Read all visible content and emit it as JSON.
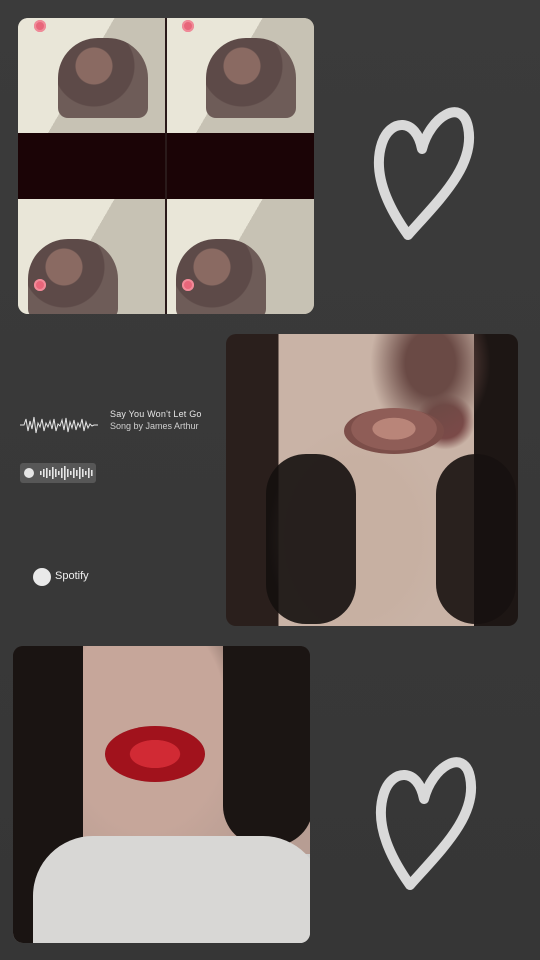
{
  "song": {
    "title": "Say You Won't Let Go",
    "artist_line": "Song by James Arthur"
  },
  "spotify": {
    "label": "Spotify",
    "icon": "spotify-icon"
  },
  "decorations": {
    "heart_icon": "heart-outline-icon",
    "heart_color": "#d9d9d9"
  },
  "colors": {
    "background": "#3a3a3a",
    "collage_band": "#1b0406"
  }
}
